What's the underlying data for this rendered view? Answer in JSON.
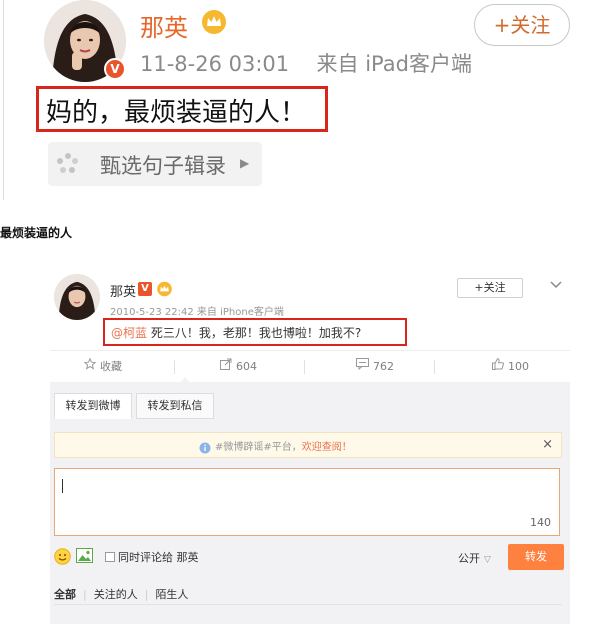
{
  "top_post": {
    "user_name": "那英",
    "timestamp": "11-8-26 03:01",
    "source": "来自 iPad客户端",
    "follow_label": "+关注",
    "text": "妈的，最烦装逼的人！",
    "source_chip_label": "甄选句子辑录"
  },
  "caption": "最烦装逼的人",
  "bottom_post": {
    "user_name": "那英",
    "verify_badge": "V",
    "meta": "2010-5-23 22:42 来自 iPhone客户端",
    "follow_label": "+关注",
    "mention": "@柯蓝",
    "text": " 死三八！我，老那！我也博啦！加我不?",
    "actions": [
      {
        "icon": "star-icon",
        "label": "收藏"
      },
      {
        "icon": "forward-icon",
        "label": "604"
      },
      {
        "icon": "comment-icon",
        "label": "762"
      },
      {
        "icon": "like-icon",
        "label": "100"
      }
    ],
    "repost_tabs": [
      "转发到微博",
      "转发到私信"
    ],
    "notice_prefix": "#微博辟谣#平台，",
    "notice_link": "欢迎查阅！",
    "notice_close": "×",
    "char_count": "140",
    "comment_option": "同时评论给 那英",
    "visibility": "公开",
    "repost_button": "转发",
    "filters": [
      "全部",
      "关注的人",
      "陌生人"
    ]
  },
  "colors": {
    "highlight_box": "#d9261c",
    "accent_orange": "#ff8140",
    "name_orange": "#e8682c"
  }
}
